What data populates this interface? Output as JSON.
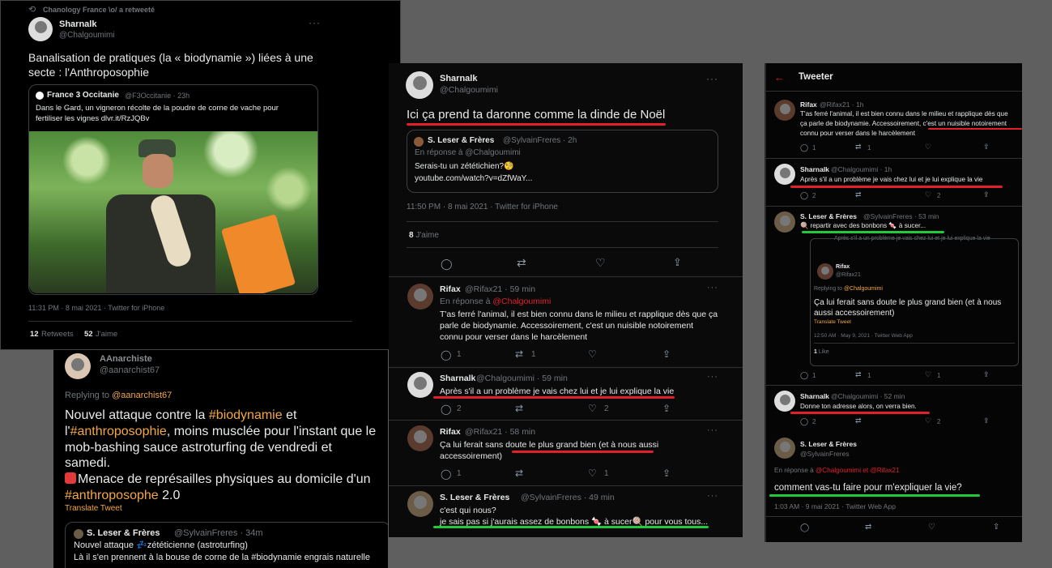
{
  "p1": {
    "retweet": "Chanology France \\o/ a retweeté",
    "name": "Sharnalk",
    "handle": "@Chalgoumimi",
    "text1": "Banalisation de pratiques (la « biodynamie ») liées à une",
    "text2": "secte : l'Anthroposophie",
    "q_name": "France 3 Occitanie",
    "q_handle": "@F3Occitanie · 23h",
    "q_text1": "Dans le Gard, un vigneron récolte de la poudre de corne de vache pour",
    "q_text2": "fertiliser les vignes dlvr.it/RzJQBv",
    "time": "11:31 PM · 8 mai 2021 · Twitter for iPhone",
    "rt_count": "12",
    "rt_label": "Retweets",
    "like_count": "52",
    "like_label": "J'aime"
  },
  "p2": {
    "name": "AAnarchiste",
    "handle": "@aanarchist67",
    "replying": "Replying to",
    "replying_to": "@aanarchist67",
    "l1a": "Nouvel attaque contre la ",
    "l1b": "#biodynamie",
    "l1c": " et",
    "l2a": "l'",
    "l2b": "#anthroposophie",
    "l2c": ", moins musclée pour l'instant que le",
    "l3": "mob-bashing sauce astroturfing de vendredi et",
    "l4": "samedi.",
    "l5": "Menace de représailles physiques au domicile d'un",
    "l6a": "#anthroposophe",
    "l6b": " 2.0",
    "translate": "Translate Tweet",
    "q_name": "S. Leser & Frères",
    "q_handle": "@SylvainFreres · 34m",
    "q_l1": "Nouvel attaque 💤zététicienne (astroturfing)",
    "q_l2": "Là il s'en prennent à la bouse de corne de la #biodynamie engrais naturelle"
  },
  "p3": {
    "name": "Sharnalk",
    "handle": "@Chalgoumimi",
    "text": "Ici ça prend ta daronne comme la dinde de Noël",
    "q_name": "S. Leser & Frères",
    "q_handle": "@SylvainFreres · 2h",
    "q_reply": "En réponse à @Chalgoumimi",
    "q_l1": "Serais-tu un zététichien?🧐",
    "q_l2": "youtube.com/watch?v=dZfWaY...",
    "time": "11:50 PM · 8 mai 2021 · Twitter for iPhone",
    "likes_n": "8",
    "likes_l": "J'aime",
    "r1": {
      "name": "Rifax",
      "handle": "@Rifax21 · 59 min",
      "reply_prefix": "En réponse à ",
      "reply_to": "@Chalgoumimi",
      "l1": "T'as ferré l'animal, il est bien connu dans le milieu et rapplique dès que ça",
      "l2": "parle de biodynamie. Accessoirement, c'est un nuisible notoirement",
      "l3": "connu pour verser dans le harcèlement",
      "c_reply": "1",
      "c_rt": "1"
    },
    "r2": {
      "name": "Sharnalk",
      "handle": "@Chalgoumimi · 59 min",
      "l1": "Après s'il a un problème je vais chez lui et je lui explique la vie",
      "c_reply": "2",
      "c_like": "2"
    },
    "r3": {
      "name": "Rifax",
      "handle": "@Rifax21 · 58 min",
      "l1": "Ça lui ferait sans doute le plus grand bien (et à nous aussi",
      "l2": "accessoirement)",
      "c_reply": "1",
      "c_like": "1"
    },
    "r4": {
      "name": "S. Leser & Frères",
      "handle": "@SylvainFreres · 49 min",
      "l1": "c'est qui nous?",
      "l2": "je sais pas si j'aurais assez de bonbons 🍬 à sucer🍭 pour vous tous..."
    }
  },
  "p4": {
    "header": "Tweeter",
    "r1": {
      "name": "Rifax",
      "handle": "@Rifax21 · 1h",
      "l1": "T'as ferré l'animal, il est bien connu dans le milieu et rapplique dès que",
      "l2": "ça parle de biodynamie. Accessoirement, c'est un nuisible notoirement",
      "l3": "connu pour verser dans le harcèlement",
      "c_reply": "1",
      "c_rt": "1"
    },
    "r2": {
      "name": "Sharnalk",
      "handle": "@Chalgoumimi · 1h",
      "l1": "Après s'il a un problème je vais chez lui et je lui explique la vie",
      "c_reply": "2",
      "c_like": "2"
    },
    "r3": {
      "name": "S. Leser & Frères",
      "handle": "@SylvainFreres · 53 min",
      "l1": "🍭 repartir avec des bonbons 🍬 à sucer...",
      "sub_q": "Après s'il a un problème je vais chez lui et je lui explique la vie",
      "inner_name": "Rifax",
      "inner_handle": "@Rifax21",
      "inner_replying": "Replying to ",
      "inner_replying_to": "@Chalgoumimi",
      "inner_l1": "Ça lui ferait sans doute le plus grand bien (et à nous",
      "inner_l2": "aussi accessoirement)",
      "inner_translate": "Translate Tweet",
      "inner_time": "12:50 AM · May 9, 2021 · Twitter Web App",
      "inner_likes": "1",
      "inner_like_label": "Like",
      "c_reply": "1",
      "c_rt": "1",
      "c_like": "1"
    },
    "r4": {
      "name": "Sharnalk",
      "handle": "@Chalgoumimi · 52 min",
      "l1": "Donne ton adresse alors, on verra bien.",
      "c_reply": "2",
      "c_like": "2"
    },
    "main": {
      "name": "S. Leser & Frères",
      "handle": "@SylvainFreres",
      "reply_prefix": "En réponse à ",
      "reply_to1": "@Chalgoumimi",
      "reply_and": " et ",
      "reply_to2": "@Rifax21",
      "text": "comment vas-tu faire pour m'expliquer la vie?",
      "time": "1:03 AM · 9 mai 2021 · Twitter Web App"
    }
  },
  "colors": {
    "red_underline": "#e0202a",
    "green_underline": "#22c93a",
    "accent": "#f4a742",
    "arrow": "#f6e21c"
  }
}
